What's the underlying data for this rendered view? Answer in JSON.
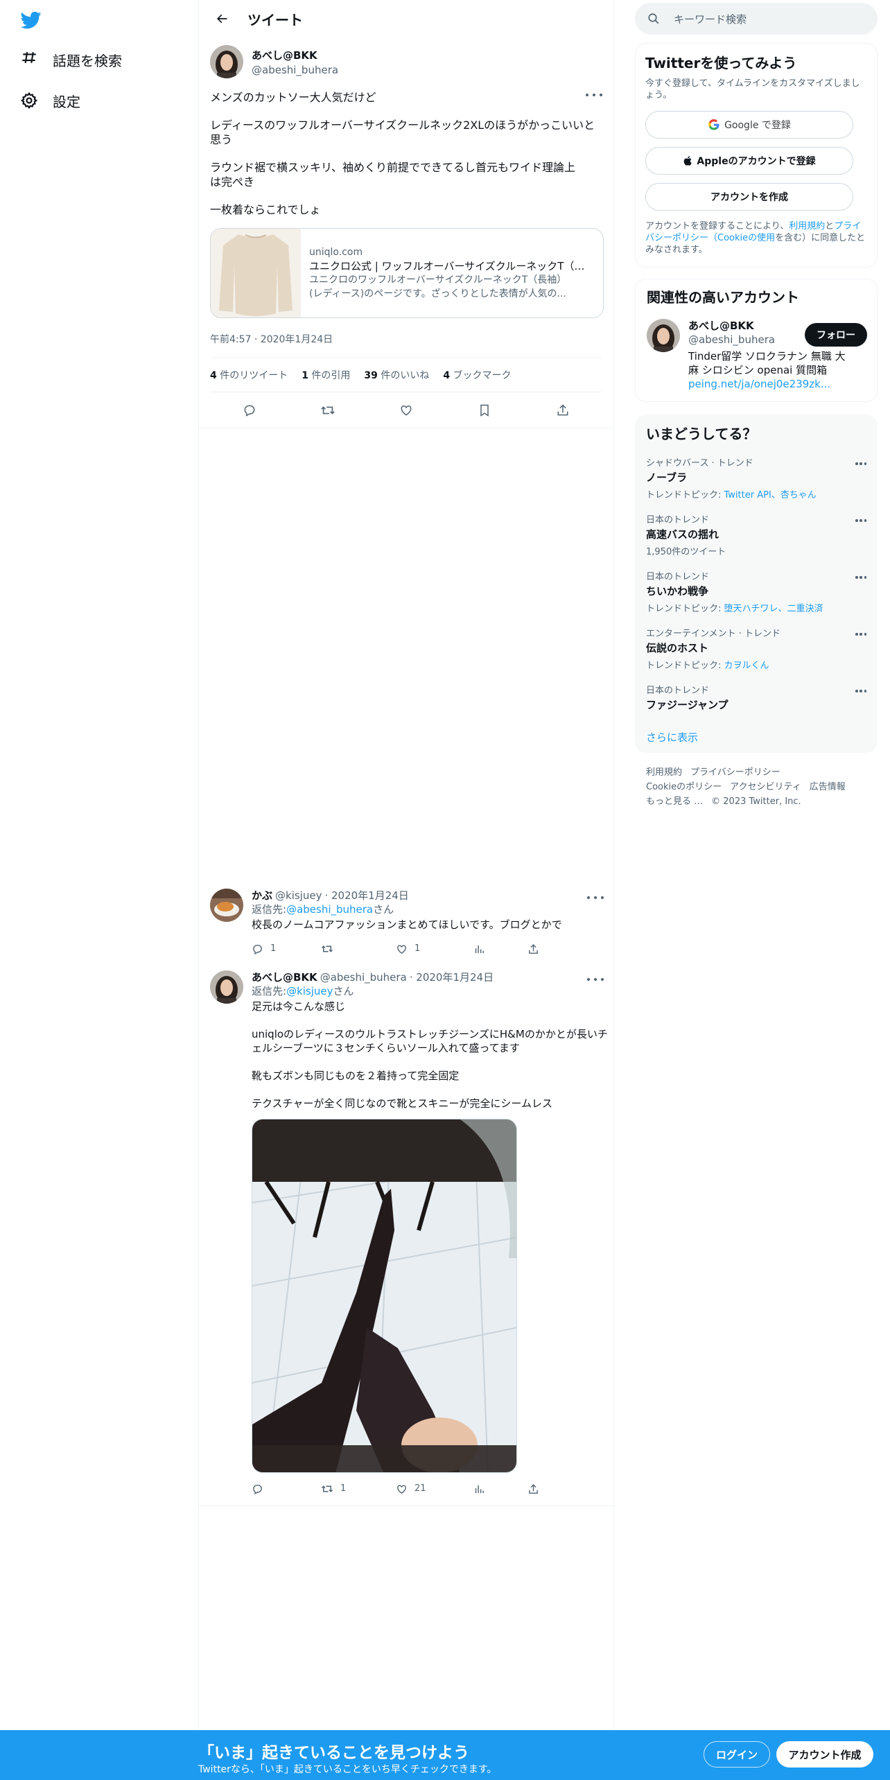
{
  "nav": {
    "explore_label": "話題を検索",
    "settings_label": "設定"
  },
  "header": {
    "title": "ツイート"
  },
  "tweet": {
    "author_name": "あべし@BKK",
    "author_handle": "@abeshi_buhera",
    "paragraphs": [
      "メンズのカットソー大人気だけど",
      "レディースのワッフルオーバーサイズクールネック2XLのほうがかっこいいと思う",
      "ラウンド裾で横スッキリ、袖めくり前提でできてるし首元もワイド理論上は完ぺき",
      "一枚着ならこれでしょ"
    ],
    "card": {
      "domain": "uniqlo.com",
      "title": "ユニクロ公式 | ワッフルオーバーサイズクルーネックT（長袖）",
      "desc_line1": "ユニクロのワッフルオーバーサイズクルーネックT（長袖）",
      "desc_line2": "(レディース)のページです。ざっくりとした表情が人気の..."
    },
    "timestamp": "午前4:57 · 2020年1月24日",
    "stats": {
      "retweets_num": "4",
      "retweets_label": "件のリツイート",
      "quotes_num": "1",
      "quotes_label": "件の引用",
      "likes_num": "39",
      "likes_label": "件のいいね",
      "bookmarks_num": "4",
      "bookmarks_label": "ブックマーク"
    }
  },
  "replies": [
    {
      "name": "かぶ",
      "handle": "@kisjuey",
      "date": "· 2020年1月24日",
      "reply_to_prefix": "返信先: ",
      "reply_to_handle": "@abeshi_buhera",
      "reply_to_suffix": "さん",
      "text": "校長のノームコアファッションまとめてほしいです。ブログとかで",
      "reply_count": "1",
      "retweet_count": "",
      "like_count": "1"
    },
    {
      "name": "あべし@BKK",
      "handle": "@abeshi_buhera",
      "date": "· 2020年1月24日",
      "reply_to_prefix": "返信先: ",
      "reply_to_handle": "@kisjuey",
      "reply_to_suffix": "さん",
      "paragraphs": [
        "足元は今こんな感じ",
        "uniqloのレディースのウルトラストレッチジーンズにH&Mのかかとが長いチェルシーブーツに３センチくらいソール入れて盛ってます",
        "靴もズボンも同じものを２着持って完全固定",
        "テクスチャーが全く同じなので靴とスキニーが完全にシームレス"
      ],
      "reply_count": "",
      "retweet_count": "1",
      "like_count": "21"
    }
  ],
  "right": {
    "search_placeholder": "キーワード検索",
    "signup": {
      "title": "Twitterを使ってみよう",
      "subtitle": "今すぐ登録して、タイムラインをカスタマイズしましょう。",
      "google_label": "Google で登録",
      "apple_label": "Appleのアカウントで登録",
      "create_label": "アカウントを作成",
      "legal_prefix": "アカウントを登録することにより、",
      "legal_terms": "利用規約",
      "legal_and": "と",
      "legal_privacy": "プライバシーポリシー",
      "legal_cookie": "（Cookieの使用",
      "legal_suffix": "を含む）に同意したとみなされます。"
    },
    "related": {
      "title": "関連性の高いアカウント",
      "name": "あべし@BKK",
      "handle": "@abeshi_buhera",
      "follow_label": "フォロー",
      "bio": "Tinder留学 ソロクラナン 無職 大麻 シロシビン openai 質問箱",
      "link": "peing.net/ja/onej0e239zk..."
    },
    "trends": {
      "title": "いまどうしてる？",
      "items": [
        {
          "context": "シャドウバース · トレンド",
          "name": "ノーブラ",
          "sub_prefix": "トレンドトピック: ",
          "sub_links": "Twitter API、杏ちゃん"
        },
        {
          "context": "日本のトレンド",
          "name": "高速バスの揺れ",
          "sub_prefix": "1,950件のツイート",
          "sub_links": ""
        },
        {
          "context": "日本のトレンド",
          "name": "ちいかわ戦争",
          "sub_prefix": "トレンドトピック: ",
          "sub_links": "堕天ハチワレ、二重決済"
        },
        {
          "context": "エンターテインメント · トレンド",
          "name": "伝説のホスト",
          "sub_prefix": "トレンドトピック: ",
          "sub_links": "カヲルくん"
        },
        {
          "context": "日本のトレンド",
          "name": "ファジージャンプ",
          "sub_prefix": "",
          "sub_links": ""
        }
      ],
      "show_more": "さらに表示"
    },
    "footer": {
      "terms": "利用規約",
      "privacy": "プライバシーポリシー",
      "cookie": "Cookieのポリシー",
      "accessibility": "アクセシビリティ",
      "ads": "広告情報",
      "more": "もっと見る …",
      "copyright": "© 2023 Twitter, Inc."
    }
  },
  "bottom": {
    "title": "「いま」起きていることを見つけよう",
    "subtitle": "Twitterなら、「いま」起きていることをいち早くチェックできます。",
    "login_label": "ログイン",
    "signup_label": "アカウント作成"
  },
  "colors": {
    "accent": "#1d9bf0",
    "text": "#0f1419",
    "secondary": "#536471"
  }
}
